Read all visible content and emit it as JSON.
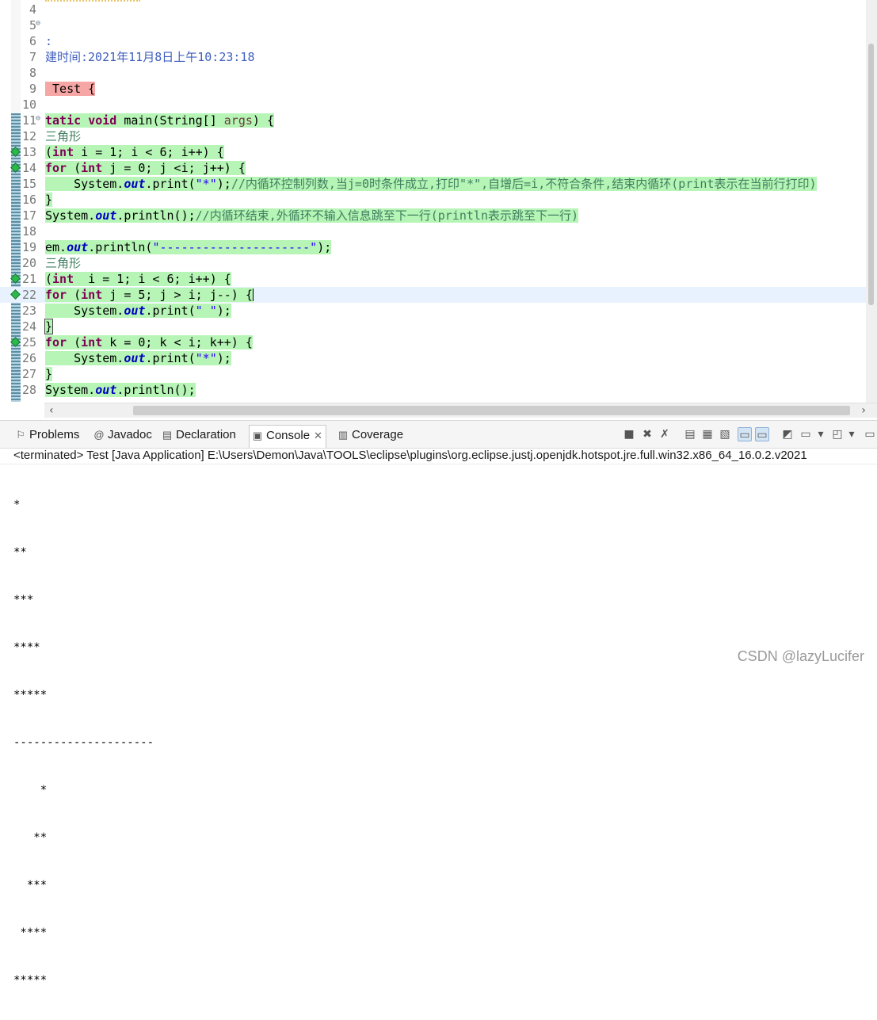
{
  "editor": {
    "lines": [
      {
        "n": "4",
        "text": ""
      },
      {
        "n": "5",
        "text": "",
        "fold": "⊖"
      },
      {
        "n": "6",
        "text": ":"
      },
      {
        "n": "7",
        "text": "建时间:2021年11月8日上午10:23:18"
      },
      {
        "n": "8",
        "text": ""
      },
      {
        "n": "9",
        "text": " Test {"
      },
      {
        "n": "10",
        "text": ""
      },
      {
        "n": "11",
        "text": "tatic void main(String[] args) {",
        "fold": "⊖"
      },
      {
        "n": "12",
        "text": "三角形"
      },
      {
        "n": "13",
        "text": "(int i = 1; i < 6; i++) {"
      },
      {
        "n": "14",
        "text": "for (int j = 0; j <i; j++) {"
      },
      {
        "n": "15",
        "text": "    System.out.print(\"*\");//内循环控制列数,当j=0时条件成立,打印\"*\",自增后=i,不符合条件,结束内循环(print表示在当前行打印)"
      },
      {
        "n": "16",
        "text": "}"
      },
      {
        "n": "17",
        "text": "System.out.println();//内循环结束,外循环不输入信息跳至下一行(println表示跳至下一行)"
      },
      {
        "n": "18",
        "text": ""
      },
      {
        "n": "19",
        "text": "em.out.println(\"---------------------\");"
      },
      {
        "n": "20",
        "text": "三角形"
      },
      {
        "n": "21",
        "text": "(int  i = 1; i < 6; i++) {"
      },
      {
        "n": "22",
        "text": "for (int j = 5; j > i; j--) {"
      },
      {
        "n": "23",
        "text": "    System.out.print(\" \");"
      },
      {
        "n": "24",
        "text": "}"
      },
      {
        "n": "25",
        "text": "for (int k = 0; k < i; k++) {"
      },
      {
        "n": "26",
        "text": "    System.out.print(\"*\");"
      },
      {
        "n": "27",
        "text": "}"
      },
      {
        "n": "28",
        "text": "System.out.println();"
      }
    ]
  },
  "panel": {
    "tabs": [
      {
        "label": "Problems",
        "icon": "problems-icon"
      },
      {
        "label": "Javadoc",
        "icon": "javadoc-icon"
      },
      {
        "label": "Declaration",
        "icon": "declaration-icon"
      },
      {
        "label": "Console",
        "icon": "console-icon",
        "active": true
      },
      {
        "label": "Coverage",
        "icon": "coverage-icon"
      }
    ],
    "status": "<terminated> Test [Java Application] E:\\Users\\Demon\\Java\\TOOLS\\eclipse\\plugins\\org.eclipse.justj.openjdk.hotspot.jre.full.win32.x86_64_16.0.2.v2021",
    "output": [
      "*",
      "**",
      "***",
      "****",
      "*****",
      "---------------------",
      "    *",
      "   **",
      "  ***",
      " ****",
      "*****"
    ]
  },
  "watermark": "CSDN @lazyLucifer",
  "colors": {
    "keyword": "#7f0055",
    "string": "#2a00ff",
    "comment": "#3f7f5f",
    "highlight_green": "#b6f5b6",
    "highlight_red": "#f7a6a6"
  }
}
